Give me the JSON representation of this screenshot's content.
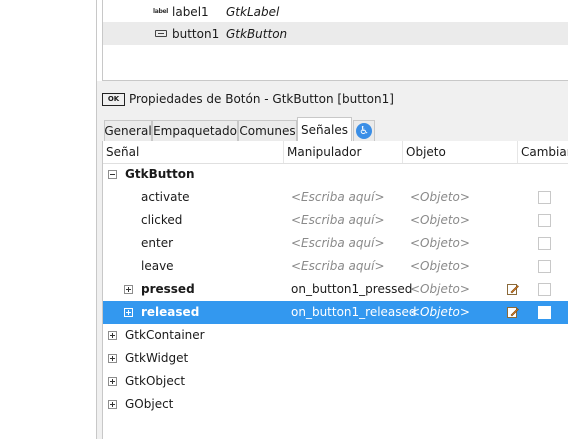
{
  "tree": {
    "items": [
      {
        "icon": "label",
        "name": "label1",
        "type": "GtkLabel"
      },
      {
        "icon": "button",
        "name": "button1",
        "type": "GtkButton"
      }
    ]
  },
  "props": {
    "ok_icon_text": "OK",
    "title": "Propiedades de Botón - GtkButton [button1]"
  },
  "tabs": [
    "General",
    "Empaquetado",
    "Comunes",
    "Señales"
  ],
  "columns": {
    "signal": "Señal",
    "handler": "Manipulador",
    "object": "Objeto",
    "swap": "Cambiar"
  },
  "rows": [
    {
      "signal": "GtkButton",
      "bold": true,
      "handler": "",
      "object": ""
    },
    {
      "signal": "activate",
      "handler": "<Escriba aquí>",
      "object": "<Objeto>"
    },
    {
      "signal": "clicked",
      "handler": "<Escriba aquí>",
      "object": "<Objeto>"
    },
    {
      "signal": "enter",
      "handler": "<Escriba aquí>",
      "object": "<Objeto>"
    },
    {
      "signal": "leave",
      "handler": "<Escriba aquí>",
      "object": "<Objeto>"
    },
    {
      "signal": "pressed",
      "bold": true,
      "handler": "on_button1_pressed",
      "object": "<Objeto>"
    },
    {
      "signal": "released",
      "bold": true,
      "handler": "on_button1_released",
      "object": "<Objeto>"
    },
    {
      "signal": "GtkContainer"
    },
    {
      "signal": "GtkWidget"
    },
    {
      "signal": "GtkObject"
    },
    {
      "signal": "GObject"
    }
  ],
  "colors": {
    "selection": "#3398ef",
    "accessibility_icon": "#3a8ee6"
  },
  "icons": {
    "accessibility": "accessibility-icon",
    "edit": "edit-handler-icon"
  }
}
